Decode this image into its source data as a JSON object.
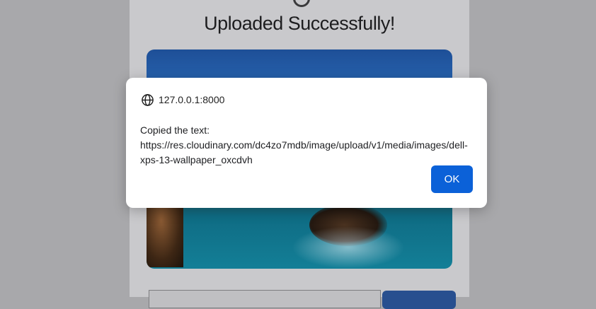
{
  "page": {
    "title": "Uploaded Successfully!"
  },
  "dialog": {
    "origin": "127.0.0.1:8000",
    "message": "Copied the text: https://res.cloudinary.com/dc4zo7mdb/image/upload/v1/media/images/dell-xps-13-wallpaper_oxcdvh",
    "ok_label": "OK",
    "origin_icon": "globe-icon"
  },
  "colors": {
    "overlay": "#a8a8ab",
    "ok_button": "#0b61d8",
    "card_button": "#284f8f"
  }
}
